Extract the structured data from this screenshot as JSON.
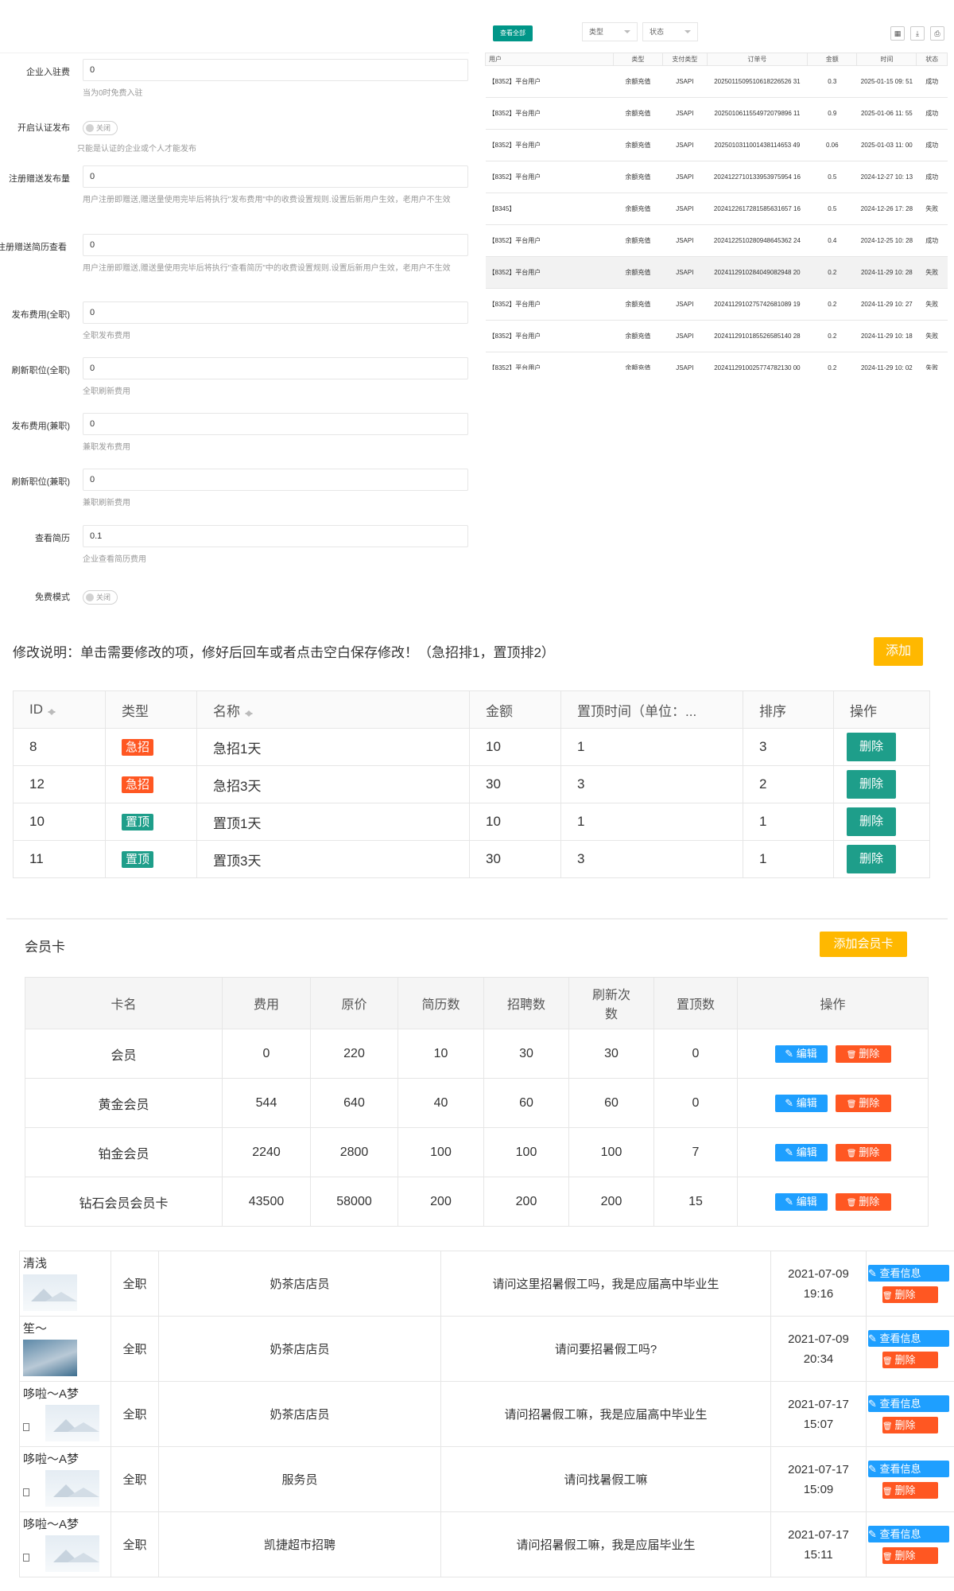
{
  "settings": [
    {
      "label": "企业入驻费",
      "type": "input",
      "value": "0",
      "hint": "当为0时免费入驻"
    },
    {
      "label": "开启认证发布",
      "type": "switch",
      "value": "关闭",
      "hint": "只能是认证的企业或个人才能发布"
    },
    {
      "label": "注册赠送发布量",
      "type": "input",
      "value": "0",
      "hint": "用户注册即赠送,赠送量使用完毕后将执行\"发布费用\"中的收费设置规则.设置后新用户生效，老用户不生效"
    },
    {
      "label": "注册赠送简历查看",
      "type": "input",
      "value": "0",
      "hint": "用户注册即赠送,赠送量使用完毕后将执行\"查看简历\"中的收费设置规则.设置后新用户生效，老用户不生效"
    },
    {
      "label": "发布费用(全职)",
      "type": "input",
      "value": "0",
      "hint": "全职发布费用"
    },
    {
      "label": "刷新职位(全职)",
      "type": "input",
      "value": "0",
      "hint": "全职刷新费用"
    },
    {
      "label": "发布费用(兼职)",
      "type": "input",
      "value": "0",
      "hint": "兼职发布费用"
    },
    {
      "label": "刷新职位(兼职)",
      "type": "input",
      "value": "0",
      "hint": "兼职刷新费用"
    },
    {
      "label": "查看简历",
      "type": "input",
      "value": "0.1",
      "hint": "企业查看简历费用"
    },
    {
      "label": "免费模式",
      "type": "switch",
      "value": "关闭",
      "hint": ""
    }
  ],
  "payments": {
    "view_all": "查看全部",
    "filter_type": "类型",
    "filter_status": "状态",
    "headers": [
      "用户",
      "类型",
      "支付类型",
      "订单号",
      "金额",
      "时间",
      "状态"
    ],
    "rows": [
      [
        "【8352】平台用户",
        "余额充值",
        "JSAPI",
        "2025011509510618226526 31",
        "0.3",
        "2025-01-15 09: 51",
        "成功"
      ],
      [
        "【8352】平台用户",
        "余额充值",
        "JSAPI",
        "2025010611554972079896 11",
        "0.9",
        "2025-01-06 11: 55",
        "成功"
      ],
      [
        "【8352】平台用户",
        "余额充值",
        "JSAPI",
        "2025010311001438114653 49",
        "0.06",
        "2025-01-03 11: 00",
        "成功"
      ],
      [
        "【8352】平台用户",
        "余额充值",
        "JSAPI",
        "2024122710133953975954 16",
        "0.5",
        "2024-12-27 10: 13",
        "成功"
      ],
      [
        "【8345】",
        "余额充值",
        "JSAPI",
        "2024122617281585631657 16",
        "0.5",
        "2024-12-26 17: 28",
        "失败"
      ],
      [
        "【8352】平台用户",
        "余额充值",
        "JSAPI",
        "2024122510280948645362 24",
        "0.4",
        "2024-12-25 10: 28",
        "成功"
      ],
      [
        "【8352】平台用户",
        "余额充值",
        "JSAPI",
        "2024112910284049082948 20",
        "0.2",
        "2024-11-29 10: 28",
        "失败"
      ],
      [
        "【8352】平台用户",
        "余额充值",
        "JSAPI",
        "2024112910275742681089 19",
        "0.2",
        "2024-11-29 10: 27",
        "失败"
      ],
      [
        "【8352】平台用户",
        "余额充值",
        "JSAPI",
        "2024112910185526585140 28",
        "0.2",
        "2024-11-29 10: 18",
        "失败"
      ],
      [
        "【8352】平台用户",
        "余额充值",
        "JSAPI",
        "2024112910025774782130 00",
        "0.2",
        "2024-11-29 10: 02",
        "失败"
      ]
    ]
  },
  "promo": {
    "note": "修改说明：单击需要修改的项，修好后回车或者点击空白保存修改！（急招排1，置顶排2）",
    "add": "添加",
    "headers": [
      "ID",
      "类型",
      "名称",
      "金额",
      "置顶时间（单位：...",
      "排序",
      "操作"
    ],
    "rows": [
      {
        "id": "8",
        "type": "急招",
        "color": "#ff5722",
        "name": "急招1天",
        "amount": "10",
        "days": "1",
        "sort": "3"
      },
      {
        "id": "12",
        "type": "急招",
        "color": "#ff5722",
        "name": "急招3天",
        "amount": "30",
        "days": "3",
        "sort": "2"
      },
      {
        "id": "10",
        "type": "置顶",
        "color": "#1e9e8a",
        "name": "置顶1天",
        "amount": "10",
        "days": "1",
        "sort": "1"
      },
      {
        "id": "11",
        "type": "置顶",
        "color": "#1e9e8a",
        "name": "置顶3天",
        "amount": "30",
        "days": "3",
        "sort": "1"
      }
    ],
    "delete": "删除"
  },
  "cards": {
    "title": "会员卡",
    "add": "添加会员卡",
    "headers": [
      "卡名",
      "费用",
      "原价",
      "简历数",
      "招聘数",
      "刷新次数",
      "置顶数",
      "操作"
    ],
    "rows": [
      [
        "会员",
        "0",
        "220",
        "10",
        "30",
        "30",
        "0"
      ],
      [
        "黄金会员",
        "544",
        "640",
        "40",
        "60",
        "60",
        "0"
      ],
      [
        "铂金会员",
        "2240",
        "2800",
        "100",
        "100",
        "100",
        "7"
      ],
      [
        "钻石会员会员卡",
        "43500",
        "58000",
        "200",
        "200",
        "200",
        "15"
      ]
    ],
    "edit": "编辑",
    "delete": "删除"
  },
  "applications": {
    "rows": [
      {
        "user": "清浅",
        "photo": false,
        "job_type": "全职",
        "job": "奶茶店店员",
        "message": "请问这里招暑假工吗，我是应届高中毕业生",
        "date": "2021-07-09",
        "time": "19:16"
      },
      {
        "user": "笙～",
        "photo": true,
        "job_type": "全职",
        "job": "奶茶店店员",
        "message": "请问要招暑假工吗?",
        "date": "2021-07-09",
        "time": "20:34"
      },
      {
        "user": "哆啦～A梦",
        "photo": false,
        "job_type": "全职",
        "job": "奶茶店店员",
        "message": "请问招暑假工嘛，我是应届高中毕业生",
        "date": "2021-07-17",
        "time": "15:07"
      },
      {
        "user": "哆啦～A梦",
        "photo": false,
        "job_type": "全职",
        "job": "服务员",
        "message": "请问找暑假工嘛",
        "date": "2021-07-17",
        "time": "15:09"
      },
      {
        "user": "哆啦～A梦",
        "photo": false,
        "job_type": "全职",
        "job": "凯捷超市招聘",
        "message": "请问招暑假工嘛，我是应届毕业生",
        "date": "2021-07-17",
        "time": "15:11"
      }
    ],
    "view": "查看信息",
    "delete": "删除"
  }
}
